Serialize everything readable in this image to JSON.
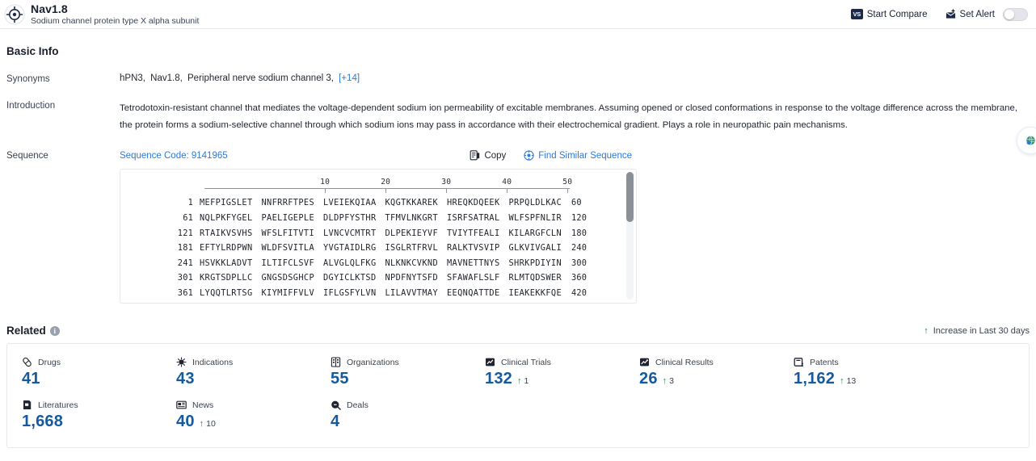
{
  "header": {
    "icon": "target-crosshair-icon",
    "title": "Nav1.8",
    "subtitle": "Sodium channel protein type X alpha subunit",
    "start_compare_label": "Start Compare",
    "start_compare_icon": "vs-icon",
    "set_alert_label": "Set Alert",
    "set_alert_icon": "alert-bell-icon",
    "alert_toggle_on": false
  },
  "basic_info": {
    "title": "Basic Info",
    "synonyms_label": "Synonyms",
    "synonyms": [
      "hPN3,",
      "Nav1.8,",
      "Peripheral nerve sodium channel 3,"
    ],
    "synonyms_more": "[+14]",
    "introduction_label": "Introduction",
    "introduction": "Tetrodotoxin-resistant channel that mediates the voltage-dependent sodium ion permeability of excitable membranes. Assuming opened or closed conformations in response to the voltage difference across the membrane, the protein forms a sodium-selective channel through which sodium ions may pass in accordance with their electrochemical gradient. Plays a role in neuropathic pain mechanisms.",
    "sequence_label": "Sequence",
    "sequence_code": "Sequence Code: 9141965",
    "copy_label": "Copy",
    "copy_icon": "copy-icon",
    "find_similar_label": "Find Similar Sequence",
    "find_similar_icon": "find-similar-icon"
  },
  "sequence": {
    "ruler": [
      10,
      20,
      30,
      40,
      50
    ],
    "rows": [
      {
        "start": "1",
        "chunks": [
          "MEFPIGSLET",
          "NNFRRFTPES",
          "LVEIEKQIAA",
          "KQGTKKAREK",
          "HREQKDQEEK",
          "PRPQLDLKAC"
        ],
        "end": "60"
      },
      {
        "start": "61",
        "chunks": [
          "NQLPKFYGEL",
          "PAELIGEPLE",
          "DLDPFYSTHR",
          "TFMVLNKGRT",
          "ISRFSATRAL",
          "WLFSPFNLIR"
        ],
        "end": "120"
      },
      {
        "start": "121",
        "chunks": [
          "RTAIKVSVHS",
          "WFSLFITVTI",
          "LVNCVCMTRT",
          "DLPEKIEYVF",
          "TVIYTFEALI",
          "KILARGFCLN"
        ],
        "end": "180"
      },
      {
        "start": "181",
        "chunks": [
          "EFTYLRDPWN",
          "WLDFSVITLA",
          "YVGTAIDLRG",
          "ISGLRTFRVL",
          "RALKTVSVIP",
          "GLKVIVGALI"
        ],
        "end": "240"
      },
      {
        "start": "241",
        "chunks": [
          "HSVKKLADVT",
          "ILTIFCLSVF",
          "ALVGLQLFKG",
          "NLKNKCVKND",
          "MAVNETTNYS",
          "SHRKPDIYIN"
        ],
        "end": "300"
      },
      {
        "start": "301",
        "chunks": [
          "KRGTSDPLLC",
          "GNGSDSGHCP",
          "DGYICLKTSD",
          "NPDFNYTSFD",
          "SFAWAFLSLF",
          "RLMTQDSWER"
        ],
        "end": "360"
      },
      {
        "start": "361",
        "chunks": [
          "LYQQTLRTSG",
          "KIYMIFFVLV",
          "IFLGSFYLVN",
          "LILAVVTMAY",
          "EEQNQATTDE",
          "IEAKEKKFQE"
        ],
        "end": "420"
      }
    ]
  },
  "related": {
    "title": "Related",
    "info_icon": "info-icon",
    "increase_note": "Increase in Last 30 days",
    "increase_icon": "up-arrow-icon",
    "cards": [
      {
        "label": "Drugs",
        "icon": "pill-icon",
        "value": "41",
        "delta": ""
      },
      {
        "label": "Indications",
        "icon": "virus-icon",
        "value": "43",
        "delta": ""
      },
      {
        "label": "Organizations",
        "icon": "building-icon",
        "value": "55",
        "delta": ""
      },
      {
        "label": "Clinical Trials",
        "icon": "clinical-trial-icon",
        "value": "132",
        "delta": "1"
      },
      {
        "label": "Clinical Results",
        "icon": "clinical-result-icon",
        "value": "26",
        "delta": "3"
      },
      {
        "label": "Patents",
        "icon": "patent-icon",
        "value": "1,162",
        "delta": "13"
      },
      {
        "label": "Literatures",
        "icon": "book-icon",
        "value": "1,668",
        "delta": ""
      },
      {
        "label": "News",
        "icon": "news-icon",
        "value": "40",
        "delta": "10"
      },
      {
        "label": "Deals",
        "icon": "deal-icon",
        "value": "4",
        "delta": ""
      }
    ]
  },
  "float_widget": {
    "icon": "chat-globe-icon"
  },
  "colors": {
    "accent_blue": "#15599f",
    "link_blue": "#2d7ada",
    "up_green": "#1f8a3b",
    "dark_navy": "#1b2a4a"
  }
}
